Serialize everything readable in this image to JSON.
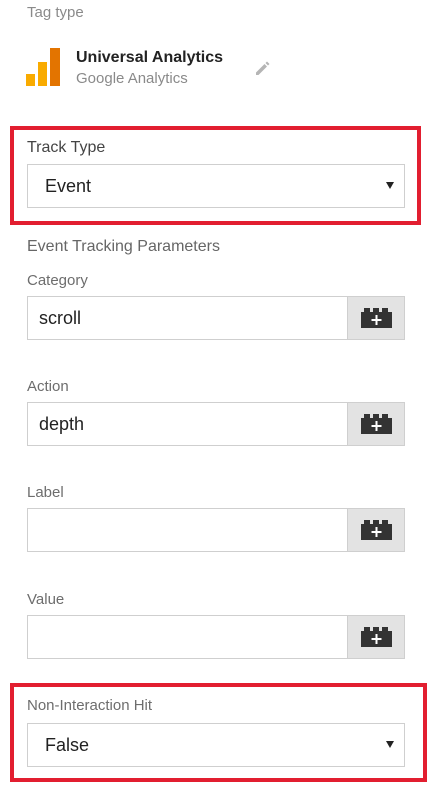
{
  "tag_type": {
    "section_label": "Tag type",
    "name": "Universal Analytics",
    "vendor": "Google Analytics",
    "icon": "google-analytics-logo",
    "edit_icon": "pencil-icon"
  },
  "track_type": {
    "label": "Track Type",
    "value": "Event"
  },
  "event_params": {
    "title": "Event Tracking Parameters",
    "fields": [
      {
        "label": "Category",
        "value": "scroll"
      },
      {
        "label": "Action",
        "value": "depth"
      },
      {
        "label": "Label",
        "value": ""
      },
      {
        "label": "Value",
        "value": ""
      }
    ],
    "variable_button_icon": "lego-brick-plus-icon"
  },
  "non_interaction": {
    "label": "Non-Interaction Hit",
    "value": "False"
  },
  "colors": {
    "highlight": "#e21e30",
    "ga_orange": "#f9ab00",
    "ga_dark_orange": "#e37400",
    "variable_button_bg": "#e3e3e3"
  }
}
